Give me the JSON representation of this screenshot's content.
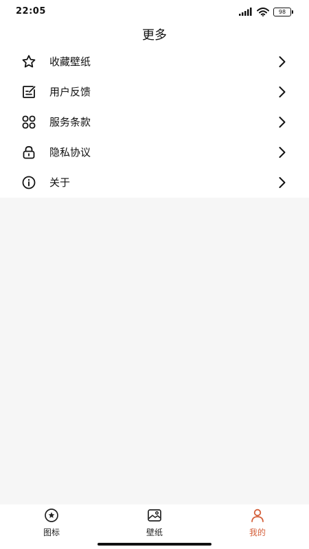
{
  "status_bar": {
    "time": "22:05",
    "battery": "98",
    "signal_icon": "signal-bars-icon",
    "wifi_icon": "wifi-icon"
  },
  "header": {
    "title": "更多"
  },
  "menu": {
    "items": [
      {
        "label": "收藏壁纸",
        "icon": "star-icon"
      },
      {
        "label": "用户反馈",
        "icon": "feedback-icon"
      },
      {
        "label": "服务条款",
        "icon": "grid-icon"
      },
      {
        "label": "隐私协议",
        "icon": "lock-icon"
      },
      {
        "label": "关于",
        "icon": "info-icon"
      }
    ]
  },
  "bottom_nav": {
    "tabs": [
      {
        "label": "图标",
        "icon": "icon-badge-icon",
        "active": false
      },
      {
        "label": "壁纸",
        "icon": "wallpaper-icon",
        "active": false
      },
      {
        "label": "我的",
        "icon": "person-icon",
        "active": true
      }
    ],
    "accent_color": "#d4603b"
  }
}
